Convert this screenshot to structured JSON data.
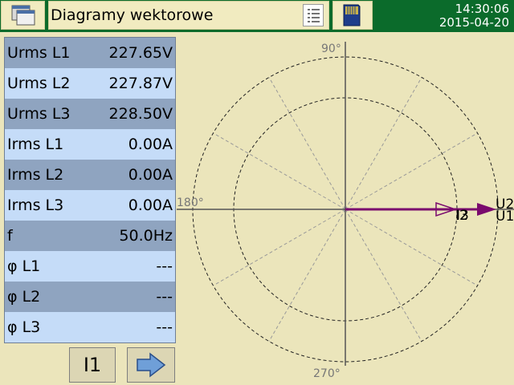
{
  "header": {
    "title": "Diagramy wektorowe",
    "time": "14:30:06",
    "date": "2015-04-20",
    "icons": {
      "window": "windows-icon",
      "list": "list-icon",
      "storage": "sd-card-icon"
    }
  },
  "measurements": [
    {
      "label": "Urms L1",
      "value": "227.65V"
    },
    {
      "label": "Urms L2",
      "value": "227.87V"
    },
    {
      "label": "Urms L3",
      "value": "228.50V"
    },
    {
      "label": "Irms L1",
      "value": "0.00A"
    },
    {
      "label": "Irms L2",
      "value": "0.00A"
    },
    {
      "label": "Irms L3",
      "value": "0.00A"
    },
    {
      "label": "f",
      "value": "50.0Hz"
    },
    {
      "label": "φ L1",
      "value": "---"
    },
    {
      "label": "φ L2",
      "value": "---"
    },
    {
      "label": "φ L3",
      "value": "---"
    }
  ],
  "buttons": {
    "channel": "I1",
    "next_icon": "arrow-right-icon"
  },
  "diagram": {
    "angle_labels": {
      "top": "90°",
      "left": "180°",
      "bottom": "270°"
    },
    "phasors": {
      "voltage_labels": [
        "U2",
        "U1"
      ],
      "current_labels": [
        "I2",
        "I3"
      ]
    },
    "colors": {
      "voltage": "#7a0a6e",
      "current_outline": "#7a0a6e",
      "axis": "#555555",
      "circle": "#222222",
      "spoke": "#999999"
    }
  }
}
